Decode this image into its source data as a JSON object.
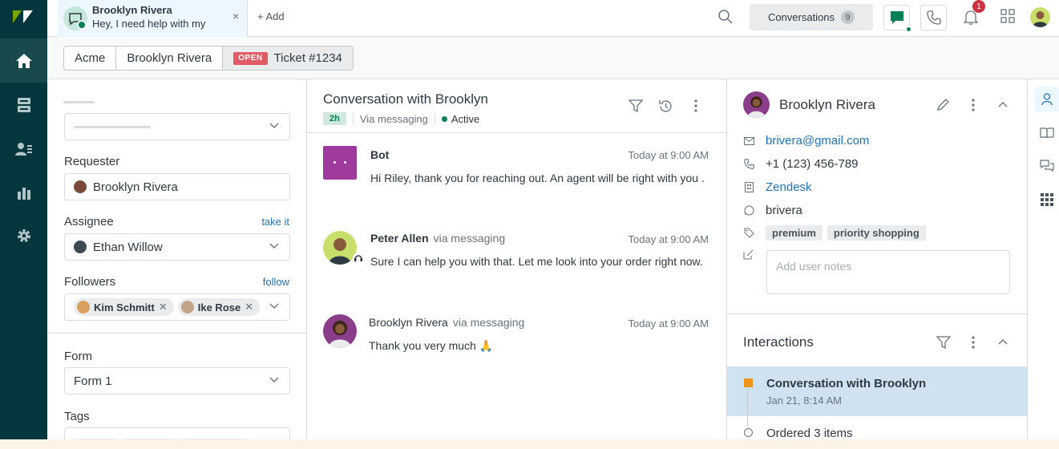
{
  "top_tab": {
    "title": "Brooklyn Rivera",
    "preview": "Hey, I need help with my",
    "close": "×"
  },
  "topbar": {
    "add_label": "+ Add",
    "conversations_label": "Conversations",
    "conversations_count": "9",
    "notifications_count": "1"
  },
  "breadcrumb": {
    "org": "Acme",
    "requester": "Brooklyn Rivera",
    "status": "OPEN",
    "ticket": "Ticket #1234"
  },
  "properties": {
    "requester_label": "Requester",
    "requester_value": "Brooklyn Rivera",
    "assignee_label": "Assignee",
    "assignee_link": "take it",
    "assignee_value": "Ethan Willow",
    "followers_label": "Followers",
    "followers_link": "follow",
    "followers": [
      "Kim Schmitt",
      "Ike Rose"
    ],
    "form_label": "Form",
    "form_value": "Form 1",
    "tags_label": "Tags"
  },
  "conversation": {
    "title": "Conversation with Brooklyn",
    "age": "2h",
    "channel": "Via messaging",
    "status": "Active",
    "messages": [
      {
        "name": "Bot",
        "via": "",
        "time": "Today at 9:00 AM",
        "text": "Hi Riley, thank you for reaching out. An agent will be right with you ."
      },
      {
        "name": "Peter Allen",
        "via": "via messaging",
        "time": "Today at 9:00 AM",
        "text": "Sure I can help you with that. Let me look into your order right now."
      },
      {
        "name": "Brooklyn Rivera",
        "via": "via messaging",
        "time": "Today at 9:00 AM",
        "text": "Thank you very much 🙏"
      }
    ]
  },
  "profile": {
    "name": "Brooklyn Rivera",
    "email": "brivera@gmail.com",
    "phone": "+1 (123) 456-789",
    "org": "Zendesk",
    "whatsapp": "brivera",
    "tags": [
      "premium",
      "priority shopping"
    ],
    "notes_placeholder": "Add user notes"
  },
  "interactions": {
    "title": "Interactions",
    "items": [
      {
        "title": "Conversation with Brooklyn",
        "date": "Jan 21, 8:14 AM"
      },
      {
        "title": "Ordered 3 items",
        "date": ""
      }
    ]
  },
  "colors": {
    "rail": "#03363d",
    "accent": "#1f73b7",
    "open_badge": "#e35b66",
    "active_green": "#038153",
    "selected_interaction": "#cee2f2"
  }
}
